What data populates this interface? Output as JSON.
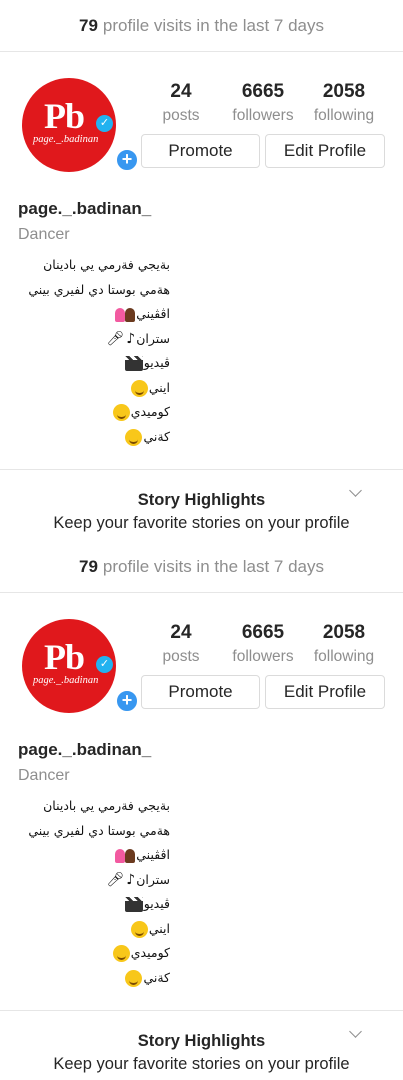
{
  "visits": {
    "count": "79",
    "text": "profile visits in the last 7 days"
  },
  "avatar": {
    "logo": "Pb",
    "name": "page._.badinan"
  },
  "stats": [
    {
      "value": "24",
      "label": "posts"
    },
    {
      "value": "6665",
      "label": "followers"
    },
    {
      "value": "2058",
      "label": "following"
    }
  ],
  "buttons": {
    "promote": "Promote",
    "edit": "Edit Profile"
  },
  "profile": {
    "username": "page._.badinan_",
    "category": "Dancer"
  },
  "bio": [
    "بةيجي فةرمي يي بادينان",
    "هةمي بوستا دي لفيري بيني",
    "اڤڤيني",
    "ستران",
    "ڤيديو",
    "ايني",
    "كوميدي",
    "كةني"
  ],
  "highlights": {
    "title": "Story Highlights",
    "subtitle": "Keep your favorite stories on your profile"
  },
  "colors": {
    "avatar_red": "#e0181c",
    "accent_blue": "#3897f0",
    "verified_blue": "#22b2f0"
  }
}
